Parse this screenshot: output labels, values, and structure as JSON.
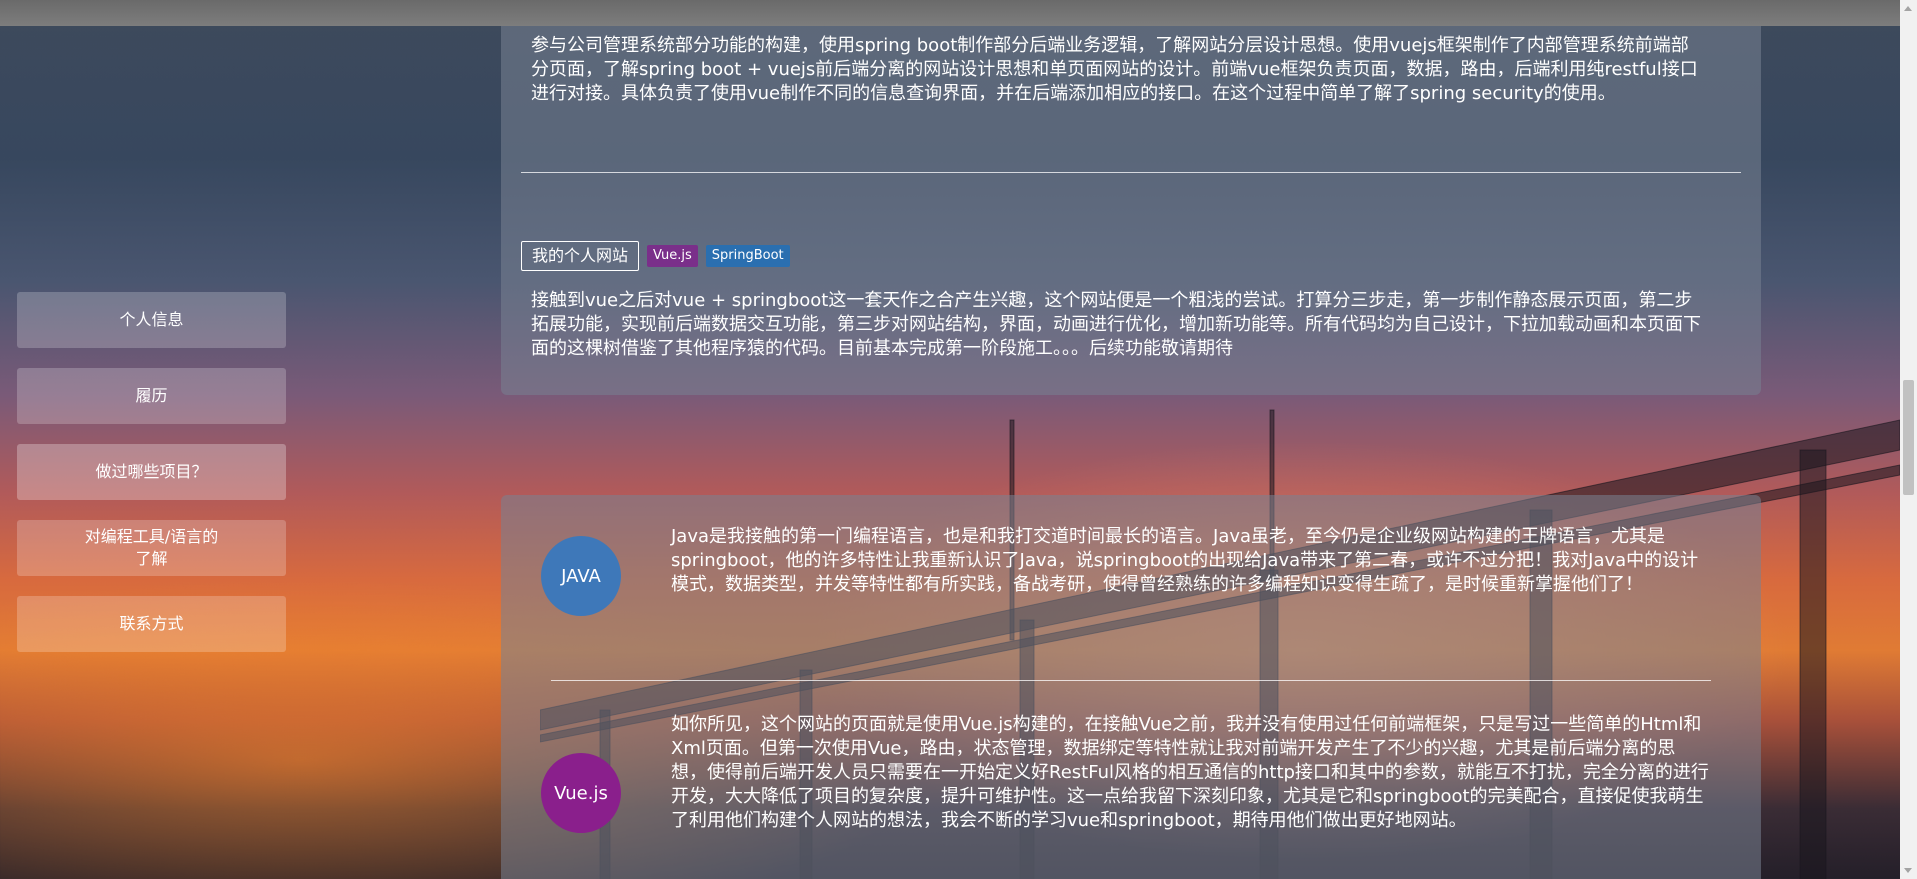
{
  "colors": {
    "java_circle": "#3e78b9",
    "vue_circle": "#8a1f8c",
    "tag_vue": "#7a2f8a",
    "tag_spring": "#2a6fb0"
  },
  "sidebar": {
    "items": [
      {
        "label": "个人信息"
      },
      {
        "label": "履历"
      },
      {
        "label": "做过哪些项目？"
      },
      {
        "label": "对编程工具/语言的了解"
      },
      {
        "label": "联系方式"
      }
    ]
  },
  "projects": {
    "company_description": "参与公司管理系统部分功能的构建，使用spring boot制作部分后端业务逻辑，了解网站分层设计思想。使用vuejs框架制作了内部管理系统前端部分页面，了解spring boot + vuejs前后端分离的网站设计思想和单页面网站的设计。前端vue框架负责页面，数据，路由，后端利用纯restful接口进行对接。具体负责了使用vue制作不同的信息查询界面，并在后端添加相应的接口。在这个过程中简单了解了spring security的使用。",
    "personal_site": {
      "title": "我的个人网站",
      "tags": [
        "Vue.js",
        "SpringBoot"
      ],
      "description": "接触到vue之后对vue + springboot这一套天作之合产生兴趣，这个网站便是一个粗浅的尝试。打算分三步走，第一步制作静态展示页面，第二步拓展功能，实现前后端数据交互功能，第三步对网站结构，界面，动画进行优化，增加新功能等。所有代码均为自己设计，下拉加载动画和本页面下面的这棵树借鉴了其他程序猿的代码。目前基本完成第一阶段施工。。。后续功能敬请期待"
    }
  },
  "skills": [
    {
      "name": "JAVA",
      "text": "Java是我接触的第一门编程语言，也是和我打交道时间最长的语言。Java虽老，至今仍是企业级网站构建的王牌语言，尤其是springboot，他的许多特性让我重新认识了Java，说springboot的出现给Java带来了第二春，或许不过分把！我对Java中的设计模式，数据类型，并发等特性都有所实践，备战考研，使得曾经熟练的许多编程知识变得生疏了，是时候重新掌握他们了！"
    },
    {
      "name": "Vue.js",
      "text": "如你所见，这个网站的页面就是使用Vue.js构建的，在接触Vue之前，我并没有使用过任何前端框架，只是写过一些简单的Html和Xml页面。但第一次使用Vue，路由，状态管理，数据绑定等特性就让我对前端开发产生了不少的兴趣，尤其是前后端分离的思想，使得前后端开发人员只需要在一开始定义好RestFul风格的相互通信的http接口和其中的参数，就能互不打扰，完全分离的进行开发，大大降低了项目的复杂度，提升可维护性。这一点给我留下深刻印象，尤其是它和springboot的完美配合，直接促使我萌生了利用他们构建个人网站的想法，我会不断的学习vue和springboot，期待用他们做出更好地网站。"
    }
  ]
}
